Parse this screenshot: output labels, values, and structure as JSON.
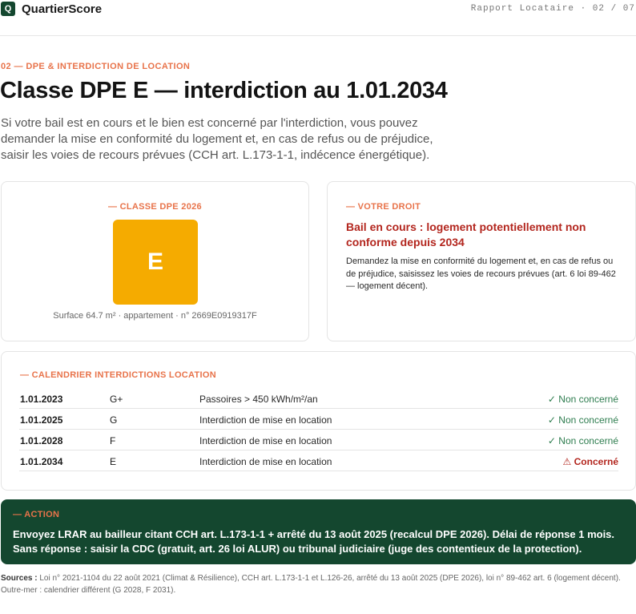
{
  "header": {
    "logo_letter": "Q",
    "brand": "QuartierScore",
    "report_ref": "Rapport Locataire · 02 / 07"
  },
  "section": {
    "eyebrow": "02 — DPE & INTERDICTION DE LOCATION",
    "title": "Classe DPE E — interdiction au 1.01.2034",
    "lead": "Si votre bail est en cours et le bien est concerné par l'interdiction, vous pouvez demander la mise en conformité du logement et, en cas de refus ou de préjudice, saisir les voies de recours prévues (CCH art. L.173-1-1, indécence énergétique)."
  },
  "dpe_card": {
    "label": "— CLASSE DPE 2026",
    "class_letter": "E",
    "class_color": "#f5ab00",
    "subtitle": "Surface 64.7 m² · appartement · n° 2669E0919317F"
  },
  "right_card": {
    "label": "— VOTRE DROIT",
    "title": "Bail en cours : logement potentiellement non conforme depuis 2034",
    "body": "Demandez la mise en conformité du logement et, en cas de refus ou de préjudice, saisissez les voies de recours prévues (art. 6 loi 89-462 — logement décent)."
  },
  "calendar": {
    "label": "— CALENDRIER INTERDICTIONS LOCATION",
    "rows": [
      {
        "date": "1.01.2023",
        "class": "G+",
        "rule": "Passoires > 450 kWh/m²/an",
        "status": "✓ Non concerné",
        "status_type": "ok"
      },
      {
        "date": "1.01.2025",
        "class": "G",
        "rule": "Interdiction de mise en location",
        "status": "✓ Non concerné",
        "status_type": "ok"
      },
      {
        "date": "1.01.2028",
        "class": "F",
        "rule": "Interdiction de mise en location",
        "status": "✓ Non concerné",
        "status_type": "ok"
      },
      {
        "date": "1.01.2034",
        "class": "E",
        "rule": "Interdiction de mise en location",
        "status": "⚠ Concerné",
        "status_type": "warn"
      }
    ]
  },
  "action": {
    "label": "— ACTION",
    "body": "Envoyez LRAR au bailleur citant CCH art. L.173-1-1 + arrêté du 13 août 2025 (recalcul DPE 2026). Délai de réponse 1 mois. Sans réponse : saisir la CDC (gratuit, art. 26 loi ALUR) ou tribunal judiciaire (juge des contentieux de la protection)."
  },
  "sources": {
    "label": "Sources :",
    "text": " Loi n° 2021-1104 du 22 août 2021 (Climat & Résilience), CCH art. L.173-1-1 et L.126-26, arrêté du 13 août 2025 (DPE 2026), loi n° 89-462 art. 6 (logement décent). Outre-mer : calendrier différent (G 2028, F 2031)."
  },
  "colors": {
    "accent": "#e8734a",
    "brand_dark": "#14472f",
    "danger": "#b3261e",
    "ok": "#2e7d4f"
  }
}
